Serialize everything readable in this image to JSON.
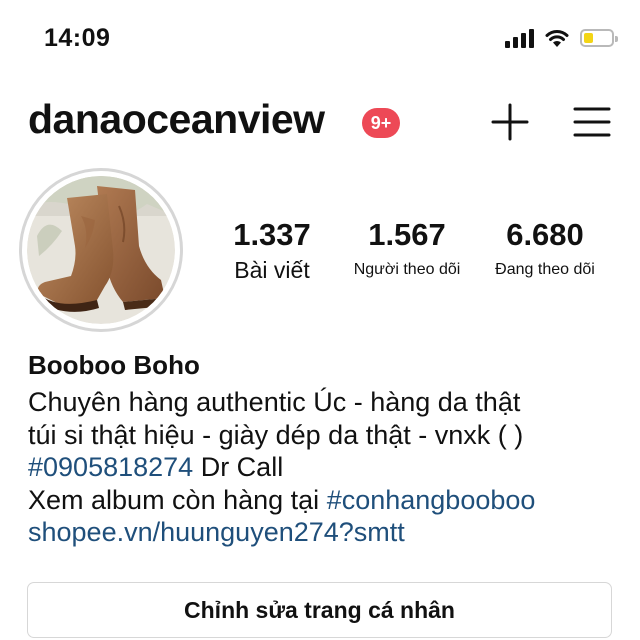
{
  "status_bar": {
    "time": "14:09",
    "signal_icon": "cellular-signal-icon",
    "wifi_icon": "wifi-icon",
    "battery_icon": "battery-low-icon",
    "battery_color": "#f3d516"
  },
  "header": {
    "username": "danaoceanview",
    "notification_badge": "9+",
    "badge_color": "#ed4956",
    "add_icon": "plus-icon",
    "menu_icon": "hamburger-menu-icon"
  },
  "profile": {
    "avatar_icon": "profile-photo-cowboy-boots",
    "stats": [
      {
        "value": "1.337",
        "label": "Bài viết"
      },
      {
        "value": "1.567",
        "label": "Người theo dõi"
      },
      {
        "value": "6.680",
        "label": "Đang theo dõi"
      }
    ],
    "display_name": "Booboo Boho",
    "bio": {
      "line1": "Chuyên hàng authentic Úc - hàng da thật",
      "line2": "túi si thật hiệu - giày dép da thật - vnxk ( )",
      "line3_link": "#0905818274",
      "line3_text": " Dr Call",
      "line4_text": "Xem album còn hàng tại ",
      "line4_link": "#conhangbooboo",
      "website": "shopee.vn/huunguyen274?smtt"
    },
    "link_color": "#1f4f7b"
  },
  "actions": {
    "edit_profile": "Chỉnh sửa trang cá nhân"
  }
}
